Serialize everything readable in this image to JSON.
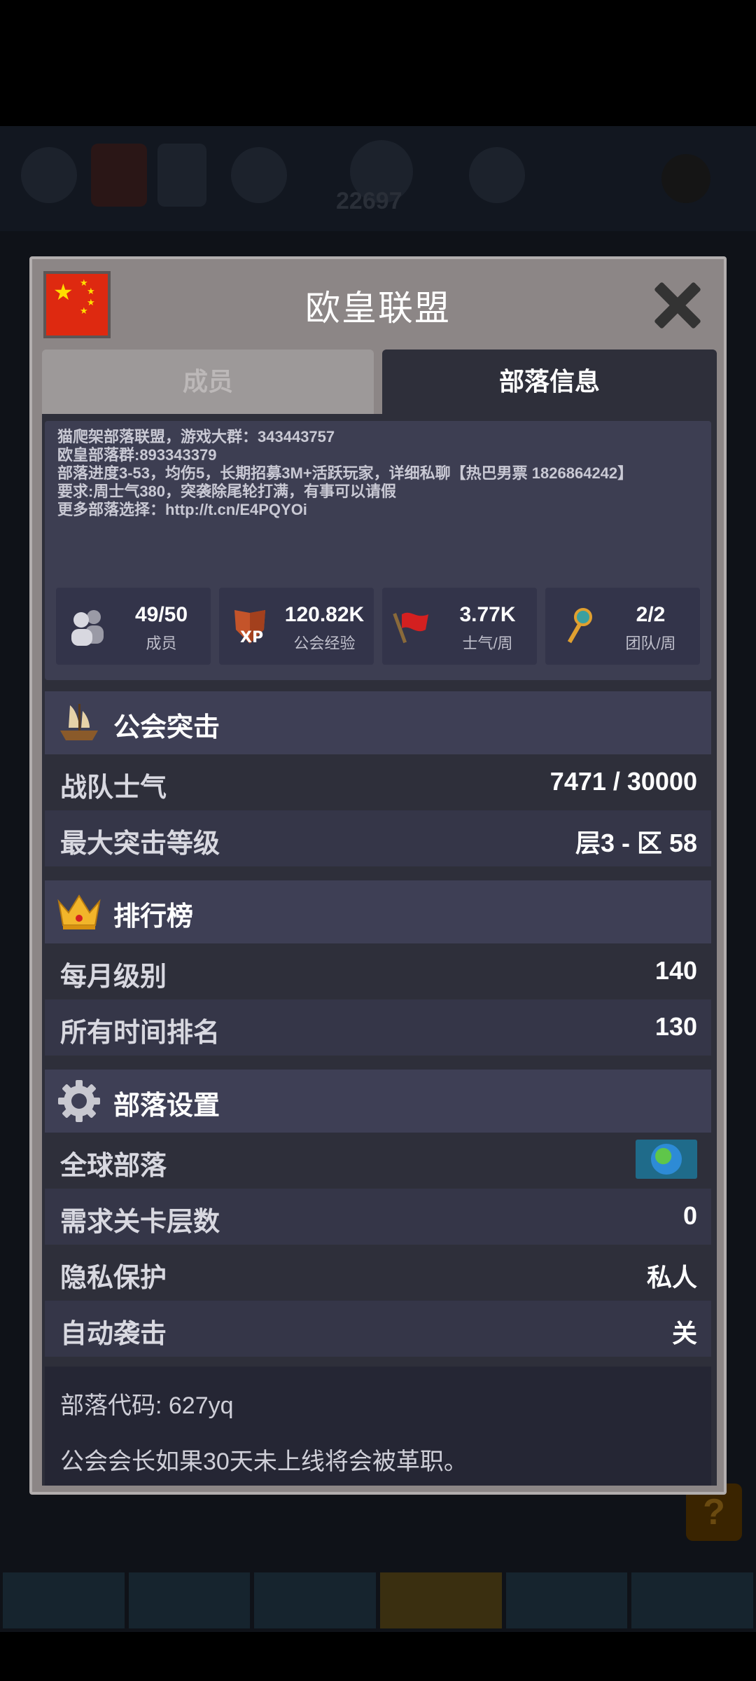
{
  "background": {
    "score": "22697"
  },
  "dialog": {
    "title": "欧皇联盟",
    "flag_icon": "china-flag",
    "close_icon": "close-x"
  },
  "tabs": [
    {
      "label": "成员",
      "active": false
    },
    {
      "label": "部落信息",
      "active": true
    }
  ],
  "description": {
    "line1_prefix": "猫爬架部落联盟，游戏大群：",
    "line1_value": "343443757",
    "line2": "欧皇部落群:893343379",
    "line3": "部落进度3-53，均伤5，长期招募3M+活跃玩家，详细私聊【热巴男票 1826864242】",
    "line4": "要求:周士气380，突袭除尾轮打满，有事可以请假",
    "line5_prefix": "更多部落选择：",
    "line5_link": "http://t.cn/E4PQYOi"
  },
  "stats": [
    {
      "icon": "members-icon",
      "value": "49/50",
      "label": "成员"
    },
    {
      "icon": "xp-shield-icon",
      "value": "120.82K",
      "label": "公会经验"
    },
    {
      "icon": "red-flag-icon",
      "value": "3.77K",
      "label": "士气/周"
    },
    {
      "icon": "key-icon",
      "value": "2/2",
      "label": "团队/周"
    }
  ],
  "raid": {
    "title": "公会突击",
    "icon": "ship-icon",
    "rows": [
      {
        "label": "战队士气",
        "value": "7471 / 30000"
      },
      {
        "label": "最大突击等级",
        "value": "层3 - 区 58"
      }
    ]
  },
  "ranking": {
    "title": "排行榜",
    "icon": "crown-icon",
    "rows": [
      {
        "label": "每月级别",
        "value": "140"
      },
      {
        "label": "所有时间排名",
        "value": "130"
      }
    ]
  },
  "settings": {
    "title": "部落设置",
    "icon": "gear-icon",
    "rows": [
      {
        "label": "全球部落",
        "value": "",
        "icon": "globe-icon"
      },
      {
        "label": "需求关卡层数",
        "value": "0"
      },
      {
        "label": "隐私保护",
        "value": "私人"
      },
      {
        "label": "自动袭击",
        "value": "关"
      }
    ]
  },
  "footer": {
    "code": "部落代码: 627yq",
    "note": "公会会长如果30天未上线将会被革职。"
  },
  "help_button": "?"
}
